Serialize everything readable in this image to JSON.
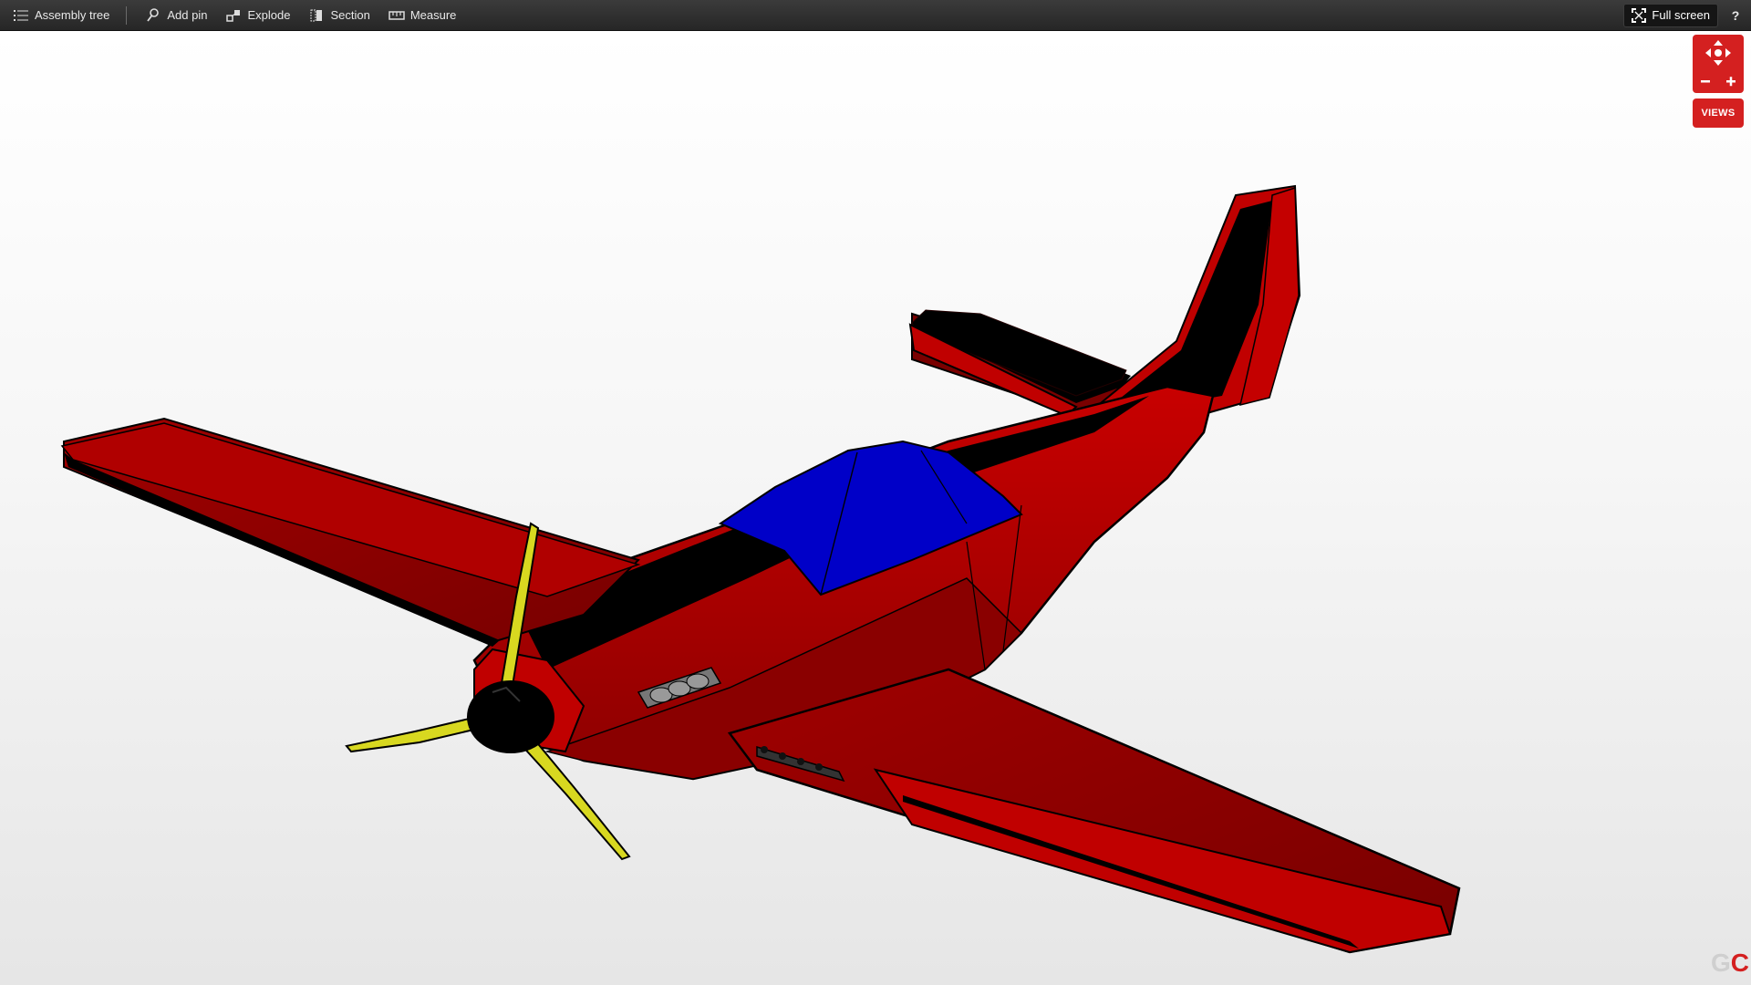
{
  "toolbar": {
    "assembly_tree": "Assembly tree",
    "add_pin": "Add pin",
    "explode": "Explode",
    "section": "Section",
    "measure": "Measure",
    "full_screen": "Full screen",
    "help": "?"
  },
  "viewer": {
    "views_label": "VIEWS",
    "logo_left": "G",
    "logo_right": "C"
  },
  "colors": {
    "accent": "#d42020",
    "body_red": "#c00000",
    "body_dark": "#800000",
    "stripe": "#000000",
    "canopy": "#0000c8",
    "propeller": "#d8d820"
  },
  "icons": {
    "assembly_tree": "list-icon",
    "add_pin": "pin-icon",
    "explode": "explode-icon",
    "section": "section-icon",
    "measure": "ruler-icon",
    "full_screen": "fullscreen-icon",
    "navigation": "pan-zoom-icon"
  }
}
